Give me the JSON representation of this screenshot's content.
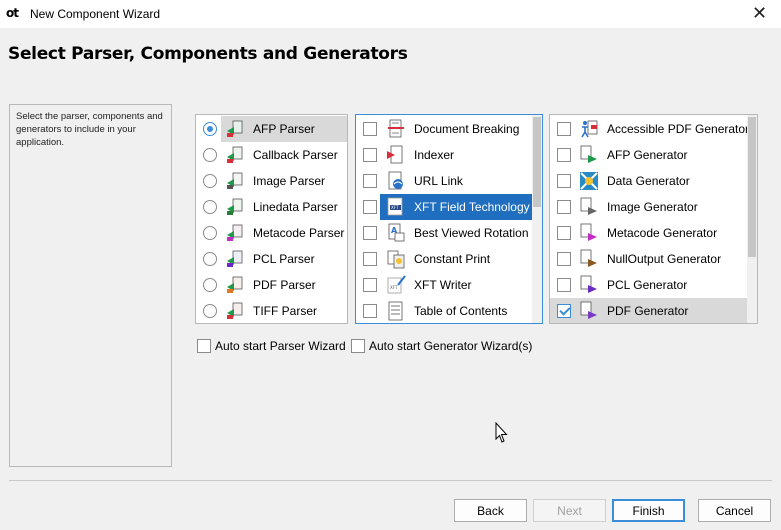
{
  "window": {
    "logo": "ot",
    "title": "New Component Wizard",
    "close_glyph": "✕"
  },
  "header": {
    "title": "Select Parser, Components and Generators"
  },
  "description": "Select the parser, components and generators to include in your application.",
  "parsers": [
    {
      "label": "AFP Parser",
      "selected": true,
      "icon": "afp-parser-icon"
    },
    {
      "label": "Callback Parser",
      "selected": false,
      "icon": "callback-parser-icon"
    },
    {
      "label": "Image Parser",
      "selected": false,
      "icon": "image-parser-icon"
    },
    {
      "label": "Linedata Parser",
      "selected": false,
      "icon": "linedata-parser-icon"
    },
    {
      "label": "Metacode Parser",
      "selected": false,
      "icon": "metacode-parser-icon"
    },
    {
      "label": "PCL Parser",
      "selected": false,
      "icon": "pcl-parser-icon"
    },
    {
      "label": "PDF Parser",
      "selected": false,
      "icon": "pdf-parser-icon"
    },
    {
      "label": "TIFF Parser",
      "selected": false,
      "icon": "tiff-parser-icon"
    }
  ],
  "components": [
    {
      "label": "Document Breaking",
      "checked": false,
      "icon": "document-breaking-icon"
    },
    {
      "label": "Indexer",
      "checked": false,
      "icon": "indexer-icon"
    },
    {
      "label": "URL Link",
      "checked": false,
      "icon": "url-link-icon"
    },
    {
      "label": "XFT Field Technology",
      "checked": false,
      "icon": "xft-field-icon",
      "highlighted": true
    },
    {
      "label": "Best Viewed Rotation",
      "checked": false,
      "icon": "rotation-icon"
    },
    {
      "label": "Constant Print",
      "checked": false,
      "icon": "constant-print-icon"
    },
    {
      "label": "XFT Writer",
      "checked": false,
      "icon": "xft-writer-icon"
    },
    {
      "label": "Table of Contents",
      "checked": false,
      "icon": "table-of-contents-icon"
    }
  ],
  "generators": [
    {
      "label": "Accessible PDF Generator",
      "checked": false,
      "icon": "accessible-pdf-icon"
    },
    {
      "label": "AFP Generator",
      "checked": false,
      "icon": "afp-generator-icon"
    },
    {
      "label": "Data Generator",
      "checked": false,
      "icon": "data-generator-icon"
    },
    {
      "label": "Image Generator",
      "checked": false,
      "icon": "image-generator-icon"
    },
    {
      "label": "Metacode Generator",
      "checked": false,
      "icon": "metacode-generator-icon"
    },
    {
      "label": "NullOutput Generator",
      "checked": false,
      "icon": "nulloutput-generator-icon"
    },
    {
      "label": "PCL Generator",
      "checked": false,
      "icon": "pcl-generator-icon"
    },
    {
      "label": "PDF Generator",
      "checked": true,
      "icon": "pdf-generator-icon",
      "highlighted": true
    }
  ],
  "options": {
    "auto_parser": "Auto start Parser Wizard",
    "auto_generator": "Auto start Generator Wizard(s)"
  },
  "buttons": {
    "back": "Back",
    "next": "Next",
    "finish": "Finish",
    "cancel": "Cancel"
  },
  "colors": {
    "accent": "#3c8dd8",
    "selection": "#1f6ebf",
    "highlight": "#d9d9d9"
  }
}
